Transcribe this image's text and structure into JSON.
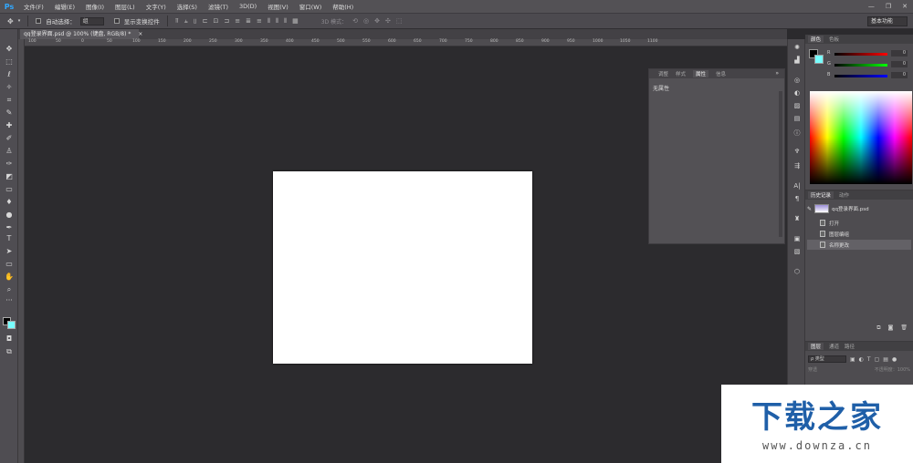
{
  "app": {
    "logo": "Ps"
  },
  "menu": [
    "文件(F)",
    "编辑(E)",
    "图像(I)",
    "图层(L)",
    "文字(Y)",
    "选择(S)",
    "滤镜(T)",
    "3D(D)",
    "视图(V)",
    "窗口(W)",
    "帮助(H)"
  ],
  "window_controls": {
    "minimize": "—",
    "restore": "❐",
    "close": "✕"
  },
  "options_bar": {
    "auto_select_label": "自动选择：",
    "auto_select_value": "组",
    "show_transform_label": "显示变换控件",
    "mode3d_label": "3D 模式：",
    "workspace": "基本功能"
  },
  "document_tab": {
    "label": "qq登录界面.psd @ 100% (键盘, RGB/8) *",
    "close": "×"
  },
  "ruler_ticks": [
    "100",
    "50",
    "0",
    "50",
    "100",
    "150",
    "200",
    "250",
    "300",
    "350",
    "400",
    "450",
    "500",
    "550",
    "600",
    "650",
    "700",
    "750",
    "800",
    "850",
    "900",
    "950",
    "1000",
    "1050",
    "1100"
  ],
  "properties_panel": {
    "tabs": [
      "调整",
      "样式",
      "属性",
      "信息"
    ],
    "active_tab": "属性",
    "content": "无属性",
    "collapse": "»"
  },
  "color_panel": {
    "tabs": [
      "颜色",
      "色板"
    ],
    "r_label": "R",
    "r_value": "0",
    "g_label": "G",
    "g_value": "0",
    "b_label": "B",
    "b_value": "0"
  },
  "history_panel": {
    "tabs": [
      "历史记录",
      "动作"
    ],
    "snapshot": "qq登录界面.psd",
    "items": [
      "打开",
      "图层编组",
      "名称更改"
    ]
  },
  "layers_panel": {
    "tabs": [
      "图层",
      "通道",
      "路径"
    ],
    "filter_label": "ρ 类型",
    "mode": "穿透",
    "opacity_label": "不透明度：",
    "opacity_value": "100%"
  },
  "watermark": {
    "title": "下载之家",
    "url": "www.downza.cn"
  }
}
